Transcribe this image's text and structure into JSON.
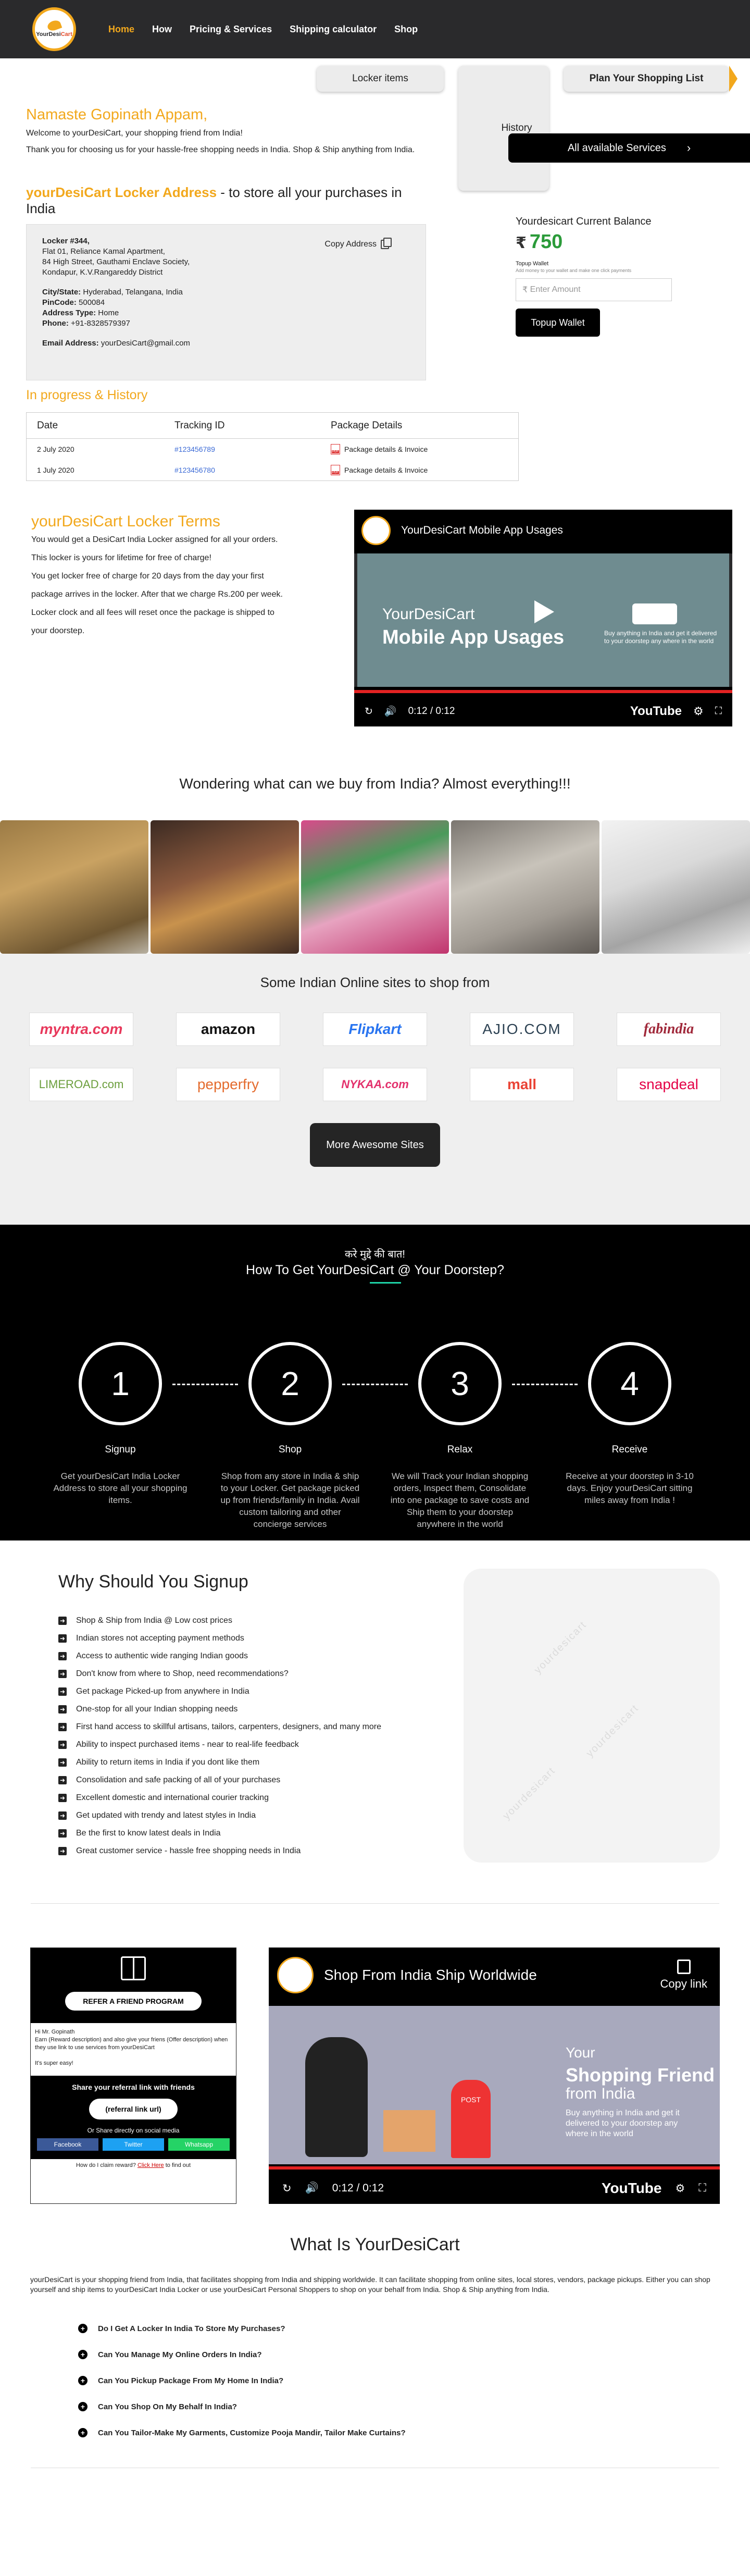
{
  "nav": {
    "logo_text_1": "YourDesi",
    "logo_text_2": "Cart",
    "links": [
      "Home",
      "How",
      "Pricing & Services",
      "Shipping calculator",
      "Shop"
    ]
  },
  "top_buttons": {
    "locker": "Locker items",
    "history": "History",
    "plan": "Plan Your Shopping List"
  },
  "welcome": {
    "greeting": "Namaste Gopinath Appam,",
    "welcome_line": "Welcome to yourDesiCart, your shopping friend from India!",
    "thanks_line": "Thank you for choosing us for your hassle-free shopping needs in India. Shop & Ship anything from India.",
    "services_button": "All available Services"
  },
  "locker": {
    "title_brand": "yourDesiCart Locker Address",
    "title_rest": "- to store all your purchases in India",
    "copy_label": "Copy Address",
    "lines": [
      "Locker #344,",
      "Flat 01, Reliance Kamal Apartment,",
      "84 High Street, Gauthami Enclave Society,",
      "Kondapur, K.V.Rangareddy District"
    ],
    "city_label": "City/State:",
    "city": "Hyderabad, Telangana, India",
    "pin_label": "PinCode:",
    "pin": "500084",
    "type_label": "Address Type:",
    "type": "Home",
    "phone_label": "Phone:",
    "phone": "+91-8328579397",
    "email_label": "Email Address:",
    "email": "yourDesiCart@gmail.com"
  },
  "balance": {
    "title": "Yourdesicart Current Balance",
    "currency": "₹",
    "amount": "750",
    "topup_label": "Topup Wallet",
    "topup_sub": "Add money to your wallet and make one click payments",
    "input_placeholder": "Enter Amount",
    "button": "Topup Wallet"
  },
  "history": {
    "title": "In progress & History",
    "columns": [
      "Date",
      "Tracking ID",
      "Package Details"
    ],
    "rows": [
      {
        "date": "2 July 2020",
        "tid": "#123456789",
        "details": "Package details & Invoice"
      },
      {
        "date": "1 July 2020",
        "tid": "#123456780",
        "details": "Package details & Invoice"
      }
    ]
  },
  "terms": {
    "title": "yourDesiCart Locker Terms",
    "lines": [
      "You would get a DesiCart India Locker assigned for all your orders.",
      "This locker is yours for lifetime for free of charge!",
      "You get locker free of charge for 20 days from the day your first",
      "package arrives in the locker. After that we charge Rs.200 per week.",
      "Locker clock and all fees will reset once the  package is shipped to",
      "your doorstep."
    ]
  },
  "video1": {
    "title": "YourDesiCart  Mobile App Usages",
    "line1": "YourDesiCart",
    "line2": "Mobile App Usages",
    "small": "Buy anything in India and get it delivered to your doorstep any where in the world",
    "time": "0:12 / 0:12",
    "brand": "YouTube"
  },
  "buy_title": "Wondering what can we buy from India? Almost everything!!!",
  "sites": {
    "title": "Some Indian Online sites to shop from",
    "items": [
      {
        "name": "myntra.com",
        "color": "#e8385b"
      },
      {
        "name": "amazon",
        "color": "#111111"
      },
      {
        "name": "Flipkart",
        "color": "#2874f0"
      },
      {
        "name": "AJIO.COM",
        "color": "#2c4152"
      },
      {
        "name": "fabindia",
        "color": "#a0283a"
      },
      {
        "name": "LIMEROAD.com",
        "color": "#6b9e3c"
      },
      {
        "name": "pepperfry",
        "color": "#e46b2d"
      },
      {
        "name": "NYKAA.com",
        "color": "#e3306c"
      },
      {
        "name": "mall",
        "color": "#ea4335"
      },
      {
        "name": "snapdeal",
        "color": "#e40046"
      }
    ],
    "more_button": "More Awesome Sites"
  },
  "how": {
    "hindi": "करे मुद्दे की बात!",
    "title": "How To Get YourDesiCart @ Your Doorstep?",
    "steps": [
      {
        "num": "1",
        "name": "Signup",
        "desc": "Get yourDesiCart India Locker Address to store all your shopping items."
      },
      {
        "num": "2",
        "name": "Shop",
        "desc": "Shop from any store in India & ship to your Locker. Get package picked up from friends/family in India. Avail custom tailoring and other concierge services"
      },
      {
        "num": "3",
        "name": "Relax",
        "desc": "We will Track your Indian shopping orders, Inspect them, Consolidate into one package to save costs and Ship them to your doorstep anywhere in the world"
      },
      {
        "num": "4",
        "name": "Receive",
        "desc": "Receive at your doorstep in 3-10 days. Enjoy yourDesiCart sitting miles away from India !"
      }
    ]
  },
  "why": {
    "title": "Why Should You Signup",
    "items": [
      "Shop & Ship from India @ Low cost prices",
      "Indian stores not accepting payment methods",
      "Access to authentic wide ranging Indian goods",
      "Don't know from where to Shop, need recommendations?",
      "Get package Picked-up from anywhere in India",
      "One-stop for all your Indian shopping needs",
      "First hand access to skillful artisans, tailors, carpenters, designers, and many more",
      "Ability to inspect purchased items - near to real-life feedback",
      "Ability to return items in India if you dont like them",
      "Consolidation and safe packing of all of your purchases",
      "Excellent domestic and international courier tracking",
      "Get updated with trendy and latest styles  in India",
      "Be the first to know latest deals in India",
      "Great customer service - hassle free shopping needs in India"
    ]
  },
  "refer": {
    "button": "REFER A FRIEND PROGRAM",
    "text": [
      "Hi Mr. Gopinath",
      "Earn (Reward description) and also give your friens (Offer description) when they use link to use services from yourDesiCart",
      "",
      "It's super easy!"
    ],
    "share": "Share your referral link with friends",
    "link": "(referral link url)",
    "or": "Or Share directly on social media",
    "socials": [
      {
        "name": "Facebook",
        "color": "#3b5998"
      },
      {
        "name": "Twitter",
        "color": "#1da1f2"
      },
      {
        "name": "Whatsapp",
        "color": "#25d366"
      }
    ],
    "foot": "How do I claim reward?",
    "foot_link": "Click Here",
    "foot_end": "to find out"
  },
  "video2": {
    "title": "Shop From India Ship Worldwide",
    "copy": "Copy link",
    "w1": "Your",
    "w2": "Shopping Friend",
    "w3": "from India",
    "w4": "Buy anything in India and get it delivered to your doorstep any where in the world",
    "post": "POST",
    "time": "0:12 / 0:12",
    "brand": "YouTube"
  },
  "what": {
    "title": "What Is YourDesiCart",
    "paragraph": "yourDesiCart is your shopping friend from India, that facilitates shopping from India and shipping worldwide. It can facilitate shopping from online sites, local stores, vendors, package pickups. Either you can shop yourself and ship items to yourDesiCart India Locker or use yourDesiCart Personal Shoppers to shop on your behalf from India. Shop & Ship anything from India.",
    "faq": [
      "Do I Get A Locker In India To Store My Purchases?",
      "Can You Manage My Online Orders In India?",
      "Can You Pickup Package From My Home In India?",
      "Can You Shop On My Behalf In India?",
      "Can You Tailor-Make My Garments, Customize Pooja Mandir, Tailor Make Curtains?"
    ]
  }
}
